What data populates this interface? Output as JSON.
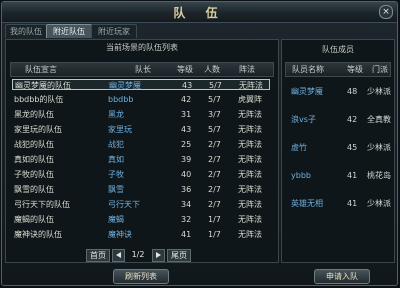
{
  "window": {
    "title": "队 伍",
    "close_label": "×"
  },
  "tabs": [
    "我的队伍",
    "附近队伍",
    "附近玩家"
  ],
  "left_panel": {
    "title": "当前场景的队伍列表",
    "headers": [
      "队伍宣言",
      "队长",
      "等级",
      "人数",
      "阵法"
    ],
    "rows": [
      {
        "slogan": "幽灵梦魇的队伍",
        "captain": "幽灵梦魇",
        "level": "43",
        "count": "5/7",
        "formation": "无阵法"
      },
      {
        "slogan": "bbdbb的队伍",
        "captain": "bbdbb",
        "level": "42",
        "count": "5/7",
        "formation": "虎翼阵"
      },
      {
        "slogan": "黑龙的队伍",
        "captain": "黑龙",
        "level": "31",
        "count": "3/7",
        "formation": "无阵法"
      },
      {
        "slogan": "家里玩的队伍",
        "captain": "家里玩",
        "level": "43",
        "count": "5/7",
        "formation": "无阵法"
      },
      {
        "slogan": "战犯的队伍",
        "captain": "战犯",
        "level": "25",
        "count": "2/7",
        "formation": "无阵法"
      },
      {
        "slogan": "真如的队伍",
        "captain": "真如",
        "level": "39",
        "count": "2/7",
        "formation": "无阵法"
      },
      {
        "slogan": "子牧的队伍",
        "captain": "子牧",
        "level": "40",
        "count": "2/7",
        "formation": "无阵法"
      },
      {
        "slogan": "飘雪的队伍",
        "captain": "飘雪",
        "level": "36",
        "count": "2/7",
        "formation": "无阵法"
      },
      {
        "slogan": "弓行天下的队伍",
        "captain": "弓行天下",
        "level": "34",
        "count": "2/7",
        "formation": "无阵法"
      },
      {
        "slogan": "魔蝎的队伍",
        "captain": "魔蝎",
        "level": "32",
        "count": "1/7",
        "formation": "无阵法"
      },
      {
        "slogan": "魔神诀的队伍",
        "captain": "魔神诀",
        "level": "41",
        "count": "1/7",
        "formation": "无阵法"
      }
    ],
    "selected_index": 0,
    "pager": {
      "first": "首页",
      "page": "1/2",
      "last": "尾页"
    }
  },
  "right_panel": {
    "title": "队伍成员",
    "headers": [
      "队员名称",
      "等级",
      "门派"
    ],
    "members": [
      {
        "name": "幽灵梦魇",
        "level": "48",
        "sect": "少林派"
      },
      {
        "name": "浪vs子",
        "level": "42",
        "sect": "全真教"
      },
      {
        "name": "虚竹",
        "level": "45",
        "sect": "少林派"
      },
      {
        "name": "ybbb",
        "level": "41",
        "sect": "桃花岛"
      },
      {
        "name": "英雄无相",
        "level": "41",
        "sect": "少林派"
      }
    ]
  },
  "buttons": {
    "refresh": "刷新列表",
    "apply": "申请入队"
  }
}
